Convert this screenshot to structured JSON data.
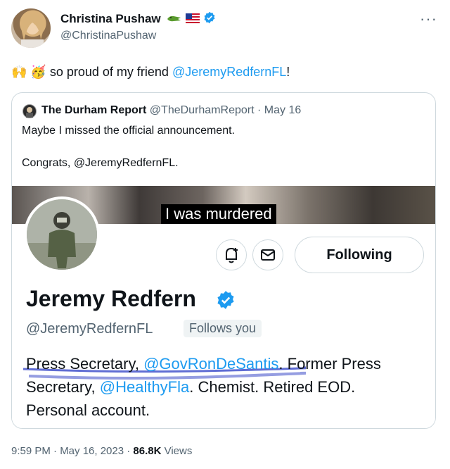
{
  "author": {
    "name": "Christina Pushaw",
    "handle": "@ChristinaPushaw"
  },
  "tweet": {
    "emojis": "🙌 🥳",
    "text_before": "so proud of my friend ",
    "mention": "@JeremyRedfernFL",
    "text_after": "!"
  },
  "quote": {
    "author_name": "The Durham Report",
    "author_handle": "@TheDurhamReport",
    "date": "· May 16",
    "line1": "Maybe I missed the official announcement.",
    "line2": "Congrats, @JeremyRedfernFL.",
    "media": {
      "caption": "I was murdered",
      "follow_button": "Following",
      "profile_name": "Jeremy Redfern",
      "profile_handle": "@JeremyRedfernFL",
      "follows_you": "Follows you",
      "bio_line1_a": "Press Secretary, ",
      "bio_line1_link": "@GovRonDeSantis",
      "bio_line1_b": ". Former Press",
      "bio_line2_a": "Secretary, ",
      "bio_line2_link": "@HealthyFla",
      "bio_line2_b": ". Chemist. Retired EOD.",
      "bio_line3": "Personal account."
    }
  },
  "footer": {
    "time": "9:59 PM · May 16, 2023 · ",
    "views_count": "86.8K",
    "views_label": " Views"
  },
  "colors": {
    "accent": "#1d9bf0",
    "muted": "#536471",
    "text": "#0f1419"
  }
}
